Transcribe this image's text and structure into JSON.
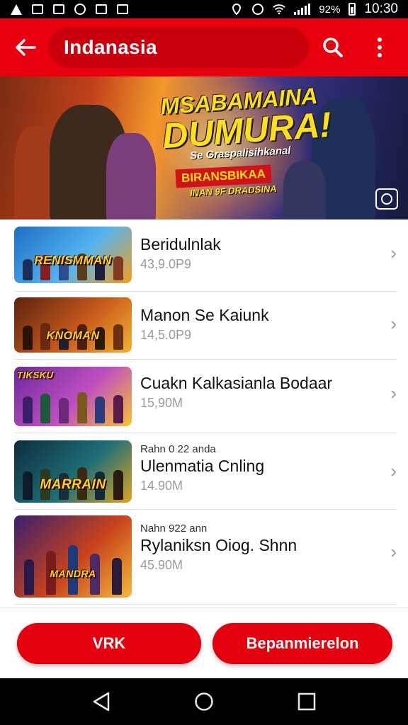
{
  "status_bar": {
    "battery": "92%",
    "time": "10:30"
  },
  "app_bar": {
    "title": "Indanasia"
  },
  "banner": {
    "title_line1": "MSABAMAINA",
    "title_line2": "DUMURA!",
    "subtitle": "Se Graspalisihkanal",
    "tag": "BIRANSBIKAA",
    "tagline": "INAN 9F DRADSINA"
  },
  "items": [
    {
      "kicker": "",
      "name": "Beridulnlak",
      "price": "43,9.0P9",
      "thumb_caption": "RENISMMAN",
      "thumb_colors": [
        "#1d6fc4",
        "#53b3f0",
        "#f2a21a"
      ]
    },
    {
      "kicker": "",
      "name": "Manon Se Kaiunk",
      "price": "14,5.0P9",
      "thumb_caption": "KNOMAN",
      "thumb_colors": [
        "#5a2410",
        "#c8591c",
        "#f5b330"
      ]
    },
    {
      "kicker": "",
      "name": "Cuakn Kalkasianla Bodaar",
      "price": "15,90M",
      "thumb_caption": "TIKSKU",
      "thumb_colors": [
        "#6a2a9e",
        "#c14fbf",
        "#f7c430"
      ]
    },
    {
      "kicker": "Rahn 0 22 anda",
      "name": "Ulenmatia Cnling",
      "price": "14.90M",
      "thumb_caption": "MARRAIN",
      "thumb_colors": [
        "#0f2c3e",
        "#1e6f78",
        "#e0a51f"
      ]
    },
    {
      "kicker": "Nahn 922 ann",
      "name": "Rylaniksn Oiog. Shnn",
      "price": "45.90M",
      "thumb_caption": "MANDRA",
      "thumb_colors": [
        "#3a1f6e",
        "#c8431c",
        "#f4b93a"
      ]
    }
  ],
  "actions": {
    "left_label": "VRK",
    "right_label": "Bepanmierelon"
  },
  "colors": {
    "primary": "#e8000f",
    "primary_dark": "#c9000b"
  }
}
